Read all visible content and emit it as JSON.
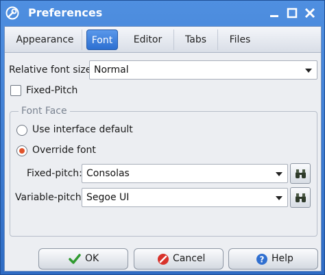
{
  "window": {
    "title": "Preferences"
  },
  "tabs": [
    {
      "label": "Appearance"
    },
    {
      "label": "Font",
      "active": true
    },
    {
      "label": "Editor"
    },
    {
      "label": "Tabs"
    },
    {
      "label": "Files"
    }
  ],
  "relative_font_size": {
    "label": "Relative font size:",
    "value": "Normal"
  },
  "fixed_pitch_checkbox": {
    "label": "Fixed-Pitch",
    "checked": false
  },
  "font_face": {
    "title": "Font Face",
    "use_default": {
      "label": "Use interface default",
      "selected": false
    },
    "override": {
      "label": "Override font",
      "selected": true
    },
    "fixed_pitch": {
      "label": "Fixed-pitch:",
      "value": "Consolas"
    },
    "variable_pitch": {
      "label": "Variable-pitch:",
      "value": "Segoe UI"
    }
  },
  "buttons": {
    "ok": "OK",
    "cancel": "Cancel",
    "help": "Help"
  },
  "colors": {
    "titlebar": "#3a78d4",
    "accent_tab": "#2c6fd1",
    "radio_selected": "#e0532b"
  }
}
